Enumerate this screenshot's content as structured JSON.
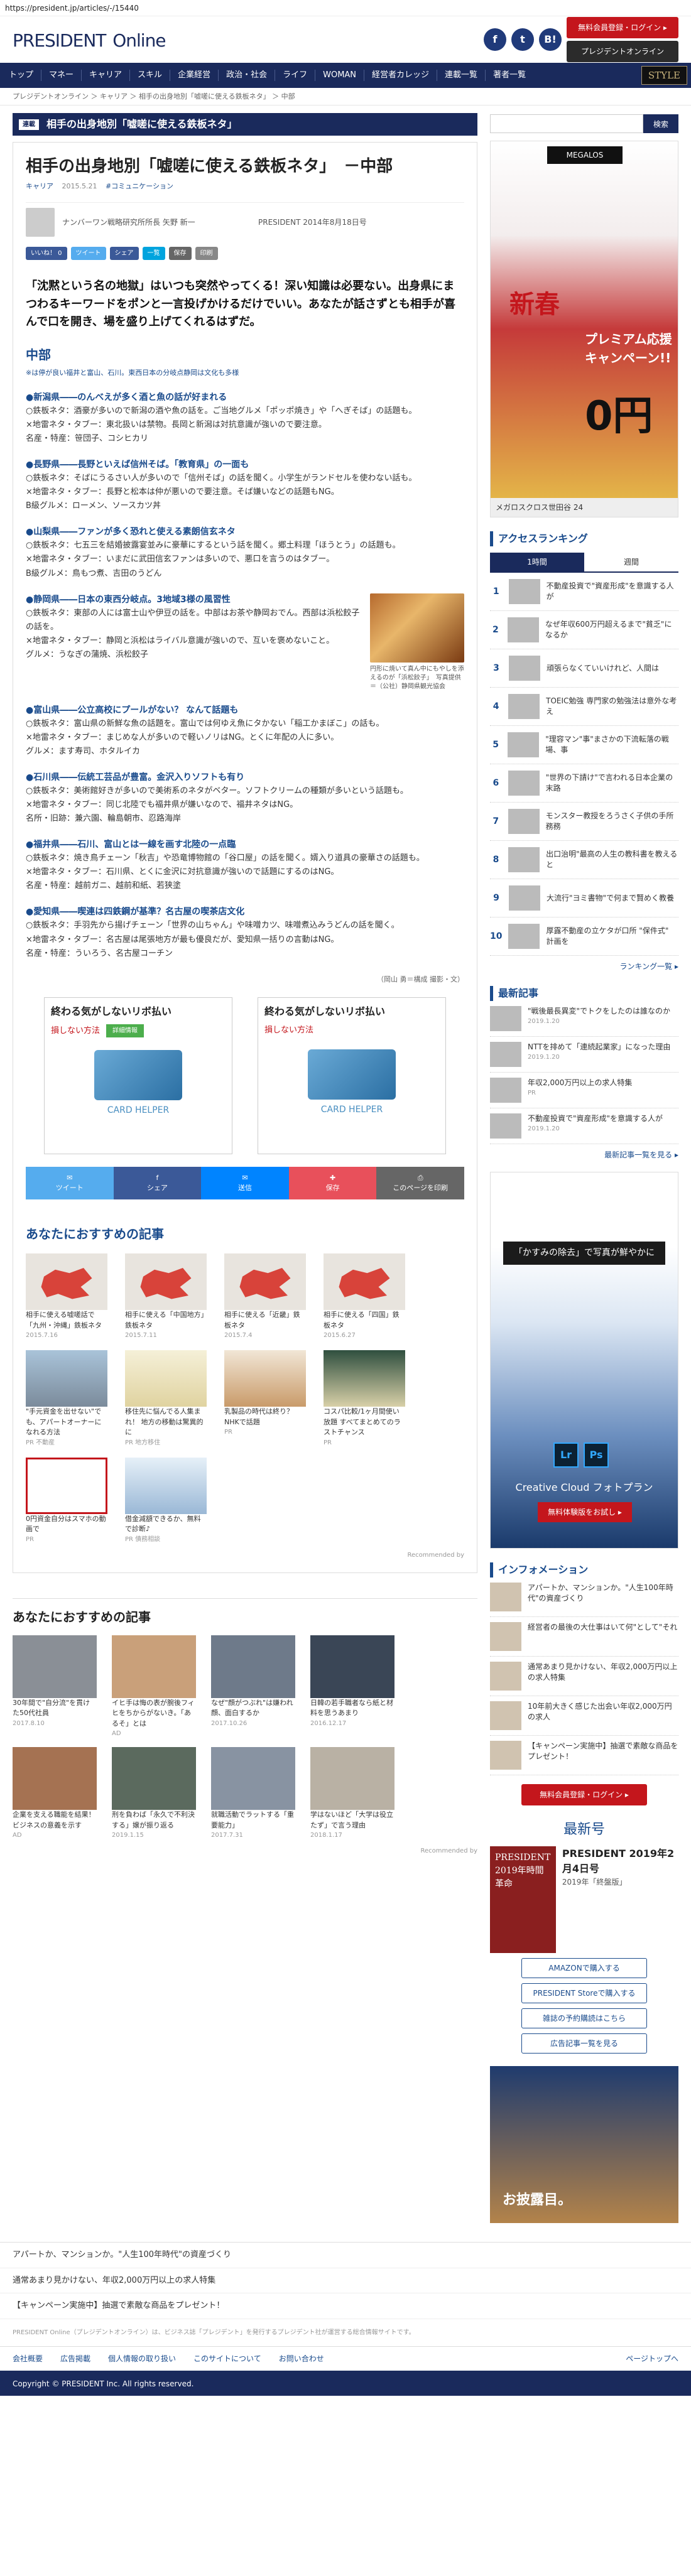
{
  "url": "https://president.jp/articles/-/15440",
  "header": {
    "logo_main": "PRESIDENT",
    "logo_sub": "Online",
    "sns": [
      "f",
      "t",
      "B!"
    ],
    "login": "無料会員登録・ログイン ▸",
    "magazine_btn": "プレジデントオンライン"
  },
  "nav": {
    "items": [
      "トップ",
      "マネー",
      "キャリア",
      "スキル",
      "企業経営",
      "政治・社会",
      "ライフ",
      "WOMAN",
      "経営者カレッジ",
      "連載一覧",
      "著者一覧"
    ],
    "style": "STYLE"
  },
  "breadcrumb": "プレジデントオンライン ＞ キャリア ＞ 相手の出身地別「嘘嗟に使える鉄板ネタ」 ＞ 中部",
  "topic": {
    "tag": "連載",
    "title": "相手の出身地別「嘘嗟に使える鉄板ネタ」"
  },
  "article": {
    "title": "相手の出身地別「嘘嗟に使える鉄板ネタ」　－中部",
    "meta": [
      "キャリア",
      "2015.5.21",
      "#コミュニケーション"
    ],
    "author": "ナンバーワン戦略研究所所長 矢野 新一",
    "pubinfo": "PRESIDENT 2014年8月18日号",
    "share": [
      "いいね！ 0",
      "ツイート",
      "シェア",
      "一覧",
      "保存",
      "印刷"
    ],
    "lead": "「沈黙という名の地獄」はいつも突然やってくる！深い知識は必要ない。出身県にまつわるキーワードをポンと一言投げかけるだけでいい。あなたが話さずとも相手が喜んで口を開き、場を盛り上げてくれるはずだ。",
    "section_title": "中部",
    "section_sub": "※は停が良い福井と富山、石川。東西日本の分岐点静岡は文化も多様",
    "prefs": [
      {
        "h": "●新潟県――のんべえが多く酒と魚の話が好まれる",
        "lines": [
          "○鉄板ネタ：酒豪が多いので新潟の酒や魚の話を。ご当地グルメ「ポッポ焼き」や「へぎそば」の話題も。",
          "×地雷ネタ・タブー：東北扱いは禁物。長岡と新潟は対抗意識が強いので要注意。",
          "名産・特産：笹団子、コシヒカリ"
        ]
      },
      {
        "h": "●長野県――長野といえば信州そば。「教育県」の一面も",
        "lines": [
          "○鉄板ネタ：そばにうるさい人が多いので「信州そば」の話を聞く。小学生がランドセルを使わない話も。",
          "×地雷ネタ・タブー：長野と松本は仲が悪いので要注意。そば嫌いなどの話題もNG。",
          "B級グルメ：ローメン、ソースカツ丼"
        ]
      },
      {
        "h": "●山梨県――ファンが多く恐れと使える素朗信玄ネタ",
        "lines": [
          "○鉄板ネタ：七五三を結婚披露宴並みに豪華にするという話を聞く。郷土料理「ほうとう」の話題も。",
          "×地雷ネタ・タブー：いまだに武田信玄ファンは多いので、悪口を言うのはタブー。",
          "B級グルメ：鳥もつ煮、吉田のうどん"
        ]
      },
      {
        "h": "●静岡県――日本の東西分岐点。3地域3様の風習性",
        "lines": [
          "○鉄板ネタ：東部の人には富士山や伊豆の話を。中部はお茶や静岡おでん。西部は浜松餃子の話を。",
          "×地雷ネタ・タブー：静岡と浜松はライバル意識が強いので、互いを褒めないこと。",
          "グルメ：うなぎの蒲焼、浜松餃子"
        ],
        "img": true
      },
      {
        "h": "●富山県――公立高校にプールがない？ なんて話題も",
        "lines": [
          "○鉄板ネタ：富山県の新鮮な魚の話題を。富山では何ゆえ魚にタかない「稲工かまぼこ」の話も。",
          "×地雷ネタ・タブー：まじめな人が多いので軽いノリはNG。とくに年配の人に多い。",
          "グルメ：ます寿司、ホタルイカ"
        ]
      },
      {
        "h": "●石川県――伝統工芸品が豊富。金沢入りソフトも有り",
        "lines": [
          "○鉄板ネタ：美術館好きが多いので美術系のネタがベター。ソフトクリームの種類が多いという話題も。",
          "×地雷ネタ・タブー：同じ北陸でも福井県が嫌いなので、福井ネタはNG。",
          "名所・旧跡：兼六園、輪島朝市、忍路海岸"
        ]
      },
      {
        "h": "●福井県――石川、富山とは一線を画す北陸の一点臨",
        "lines": [
          "○鉄板ネタ：焼き鳥チェーン「秋吉」や恐竜博物館の「谷口屋」の話を聞く。婿入り道具の豪華さの話題も。",
          "×地雷ネタ・タブー：石川県、とくに金沢に対抗意識が強いので話題にするのはNG。",
          "名産・特産：越前ガニ、越前和紙、若狭塗"
        ]
      },
      {
        "h": "●愛知県――喫連は四鉄鋼が基準？名古屋の喫茶店文化",
        "lines": [
          "○鉄板ネタ：手羽先から揚げチェーン「世界の山ちゃん」や味噌カツ、味噌煮込みうどんの話を聞く。",
          "×地雷ネタ・タブー：名古屋は尾張地方が最も優良だが、愛知県一括りの言動はNG。",
          "名産・特産：ういろう、名古屋コーチン"
        ]
      }
    ],
    "caption": "円形に焼いて真ん中にもやしを添えるのが「浜松餃子」　写真提供＝（公社）静岡県観光協会",
    "credit": "（岡山 勇＝構成 撮影・文）"
  },
  "ads": [
    {
      "title": "終わる気がしないリボ払い",
      "sub": "損しない方法",
      "tag": "詳細情報",
      "brand": "CARD HELPER"
    },
    {
      "title": "終わる気がしないリボ払い",
      "sub": "損しない方法",
      "tag": "",
      "brand": "CARD HELPER"
    }
  ],
  "share_big": [
    {
      "icon": "✉",
      "label": "ツイート",
      "color": "#55acee"
    },
    {
      "icon": "f",
      "label": "シェア",
      "color": "#3b5998"
    },
    {
      "icon": "✉",
      "label": "送信",
      "color": "#0084ff"
    },
    {
      "icon": "✚",
      "label": "保存",
      "color": "#e8505b"
    },
    {
      "icon": "⎙",
      "label": "このページを印刷",
      "color": "#666"
    }
  ],
  "rec1": {
    "heading": "あなたにおすすめの記事",
    "items": [
      {
        "t": "相手に使える嘘嗟話で「九州・沖縄」鉄板ネタ",
        "d": "2015.7.16"
      },
      {
        "t": "相手に使える「中国地方」鉄板ネタ",
        "d": "2015.7.11"
      },
      {
        "t": "相手に使える「近畿」鉄板ネタ",
        "d": "2015.7.4"
      },
      {
        "t": "相手に使える「四国」鉄板ネタ",
        "d": "2015.6.27"
      }
    ],
    "ads": [
      {
        "t": "\"手元資金を出せない\"でも、アパートオーナーになれる方法",
        "s": "PR 不動産"
      },
      {
        "t": "移住先に悩んでる人集まれ！ 地方の移動は驚異的に",
        "s": "PR 地方移住"
      },
      {
        "t": "乳製品の時代は終り？NHKで話題",
        "s": "PR"
      },
      {
        "t": "コスパ比較/1ヶ月間使い放題 すべてまとめてのラストチャンス",
        "s": "PR"
      }
    ],
    "ads2": [
      {
        "t": "0円資金自分はスマホの動画で",
        "s": "PR"
      },
      {
        "t": "借金減額できるか、無料で診断♪",
        "s": "PR 債務相談"
      }
    ],
    "powered": "Recommended by"
  },
  "rec2": {
    "heading": "あなたにおすすめの記事",
    "items": [
      {
        "t": "30年間で\"自分流\"を貫けた50代社員",
        "s": "2017.8.10"
      },
      {
        "t": "イヒ手は悔の表が腕後フィヒをちからがないき。「あるそ」とは",
        "s": "AD"
      },
      {
        "t": "なぜ\"顔がつぶれ\"は嫌われ顔、面白するか",
        "s": "2017.10.26"
      },
      {
        "t": "日韓の若手職者なら紙と材料を思うあまり",
        "s": "2016.12.17"
      },
      {
        "t": "企業を支える職能を結果！ビジネスの意義を示す",
        "s": "AD"
      },
      {
        "t": "刑を負わば「永久で不利決する」嬢が振り返る",
        "s": "2019.1.15"
      },
      {
        "t": "就職活動でラットする「重要能力」",
        "s": "2017.7.31"
      },
      {
        "t": "学はないほど「大学は役立たず」で言う理由",
        "s": "2018.1.17"
      }
    ],
    "powered": "Recommended by"
  },
  "footer": {
    "links": [
      "アパートか、マンションか。\"人生100年時代\"の資産づくり",
      "通常あまり見かけない、年収2,000万円以上の求人特集",
      "【キャンペーン実施中】抽選で素敵な商品をプレゼント！"
    ],
    "fine": "PRESIDENT Online（プレジデントオンライン）は、ビジネス誌「プレジデント」を発行するプレジデント社が運営する総合情報サイトです。",
    "nav": [
      "会社概要",
      "広告掲載",
      "個人情報の取り扱い",
      "このサイトについて",
      "お問い合わせ"
    ],
    "top": "ページトップへ",
    "copyright": "Copyright © PRESIDENT Inc. All rights reserved."
  },
  "side": {
    "search_placeholder": "",
    "search_btn": "検索",
    "ad1": {
      "brand": "MEGALOS",
      "tx1": "新春",
      "tx2": "プレミアム応援キャンペーン!!",
      "tx3": "0円",
      "foot": "メガロスクロス世田谷 24"
    },
    "rank_h": "アクセスランキング",
    "tabs": [
      "1時間",
      "週間"
    ],
    "rank": [
      "不動産投資で\"資産形成\"を意識する人が",
      "なぜ年収600万円超えるまで\"貧乏\"になるか",
      "頑張らなくていいけれど、人間は",
      "TOEIC勉強 専門家の勉強法は意外な考え",
      "\"理容マン\"事\"まさかの下流転落の戦場、事",
      "\"世界の下請け\"で言われる日本企業の末路",
      "モンスター教授をろうさく子供の手所務務",
      "出口治明\"最高の人生の教科書を教えると",
      "大流行\"ヨミ書物\"で何まで賢めく教養",
      "厚露不動産の立ケタが口所 \"保件式\" 計画を"
    ],
    "rank_more": "ランキング一覧 ▸",
    "latest_h": "最新記事",
    "latest": [
      {
        "t": "\"戦後最長異変\"でトクをしたのは誰なのか",
        "m": "2019.1.20"
      },
      {
        "t": "NTTを排めて「連続起業家」になった理由",
        "m": "2019.1.20"
      },
      {
        "t": "年収2,000万円以上の求人特集",
        "m": "PR"
      },
      {
        "t": "不動産投資で\"資産形成\"を意識する人が",
        "m": "2019.1.20"
      }
    ],
    "latest_more": "最新記事一覧を見る ▸",
    "ad2": {
      "t": "「かすみの除去」で写真が鮮やかに",
      "name": "Creative Cloud フォトプラン",
      "btn": "無料体験版をお試し ▸",
      "apps": [
        "Lr",
        "Ps"
      ]
    },
    "info_h": "インフォメーション",
    "info": [
      "アパートか、マンションか。\"人生100年時代\"の資産づくり",
      "経営者の最後の大仕事はいて何\"として\"それ",
      "通常あまり見かけない、年収2,000万円以上の求人特集",
      "10年前大きく感じた出会い年収2,000万円の求人",
      "【キャンペーン実施中】抽選で素敵な商品をプレゼント！"
    ],
    "info_btn": "無料会員登録・ログイン ▸",
    "mag_h": "最新号",
    "mag": {
      "cover": "PRESIDENT 2019年時間革命",
      "title": "PRESIDENT 2019年2月4日号",
      "sub": "2019年「終盤版」"
    },
    "mag_btns": [
      "AMAZONで購入する",
      "PRESIDENT Storeで購入する",
      "雑誌の予約購読はこちら",
      "広告記事一覧を見る"
    ],
    "ad3": {
      "t": "お披露目。"
    }
  }
}
